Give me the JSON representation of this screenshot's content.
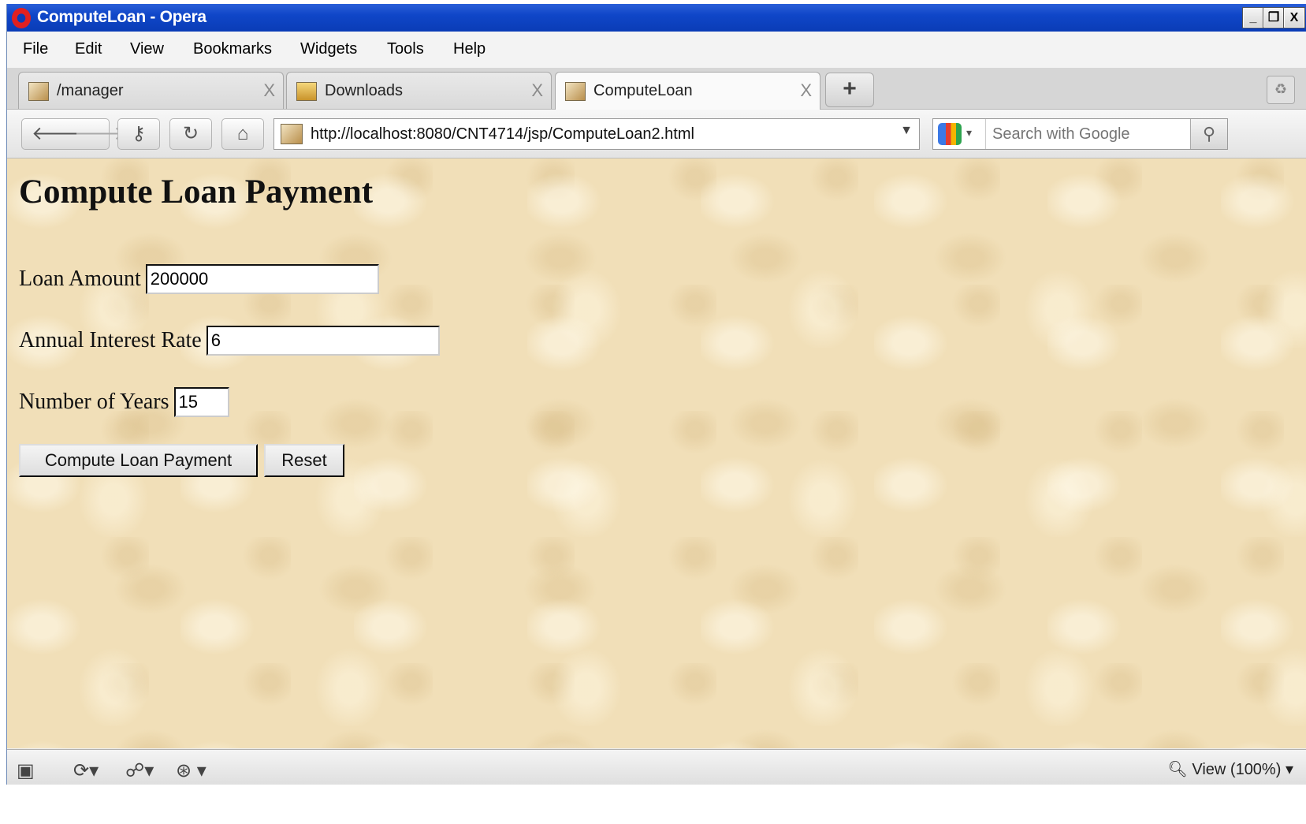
{
  "window": {
    "title": "ComputeLoan - Opera",
    "controls": {
      "minimize": "_",
      "restore": "❐",
      "close": "X"
    }
  },
  "menu": {
    "items": [
      "File",
      "Edit",
      "View",
      "Bookmarks",
      "Widgets",
      "Tools",
      "Help"
    ]
  },
  "tabs": [
    {
      "label": "/manager",
      "close": "X"
    },
    {
      "label": "Downloads",
      "close": "X"
    },
    {
      "label": "ComputeLoan",
      "close": "X"
    }
  ],
  "new_tab": "+",
  "navbar": {
    "url": "http://localhost:8080/CNT4714/jsp/ComputeLoan2.html",
    "search_placeholder": "Search with Google"
  },
  "page": {
    "heading": "Compute Loan Payment",
    "fields": {
      "loan_amount": {
        "label": "Loan Amount",
        "value": "200000"
      },
      "interest_rate": {
        "label": "Annual Interest Rate",
        "value": "6"
      },
      "years": {
        "label": "Number of Years",
        "value": "15"
      }
    },
    "buttons": {
      "submit": "Compute Loan Payment",
      "reset": "Reset"
    }
  },
  "statusbar": {
    "zoom": "View (100%)"
  }
}
